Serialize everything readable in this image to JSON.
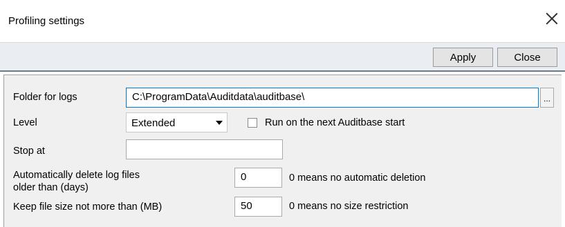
{
  "window": {
    "title": "Profiling settings",
    "close_icon": "close-icon"
  },
  "toolbar": {
    "apply_label": "Apply",
    "close_label": "Close"
  },
  "form": {
    "folder_label": "Folder for logs",
    "folder_value": "C:\\ProgramData\\Auditdata\\auditbase\\",
    "browse_label": "...",
    "level_label": "Level",
    "level_value": "Extended",
    "run_next_start_label": "Run on the next Auditbase start",
    "run_next_start_checked": false,
    "stop_at_label": "Stop at",
    "stop_at_value": "",
    "auto_delete_label_line1": "Automatically delete log files",
    "auto_delete_label_line2": "older than (days)",
    "auto_delete_value": "0",
    "auto_delete_hint": "0 means no automatic deletion",
    "max_size_label": "Keep file size not more than (MB)",
    "max_size_value": "50",
    "max_size_hint": "0 means no size restriction"
  },
  "colors": {
    "toolbar_bg": "#eaeef2",
    "content_bg": "#f0f0f0",
    "focus_border": "#0078d7"
  }
}
